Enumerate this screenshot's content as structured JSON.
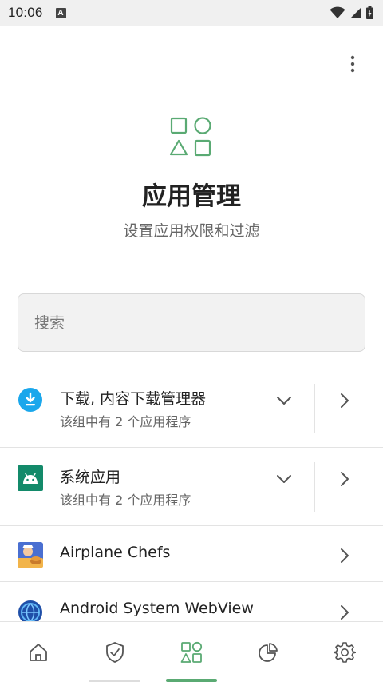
{
  "status_bar": {
    "time": "10:06",
    "a_label": "A"
  },
  "header": {
    "title": "应用管理",
    "subtitle": "设置应用权限和过滤",
    "icon": "apps-shapes-icon"
  },
  "search": {
    "placeholder": "搜索",
    "value": ""
  },
  "list": {
    "groups": [
      {
        "title": "下载, 内容下载管理器",
        "subtitle": "该组中有 2 个应用程序",
        "icon": "download-icon"
      },
      {
        "title": "系统应用",
        "subtitle": "该组中有 2 个应用程序",
        "icon": "android-icon"
      }
    ],
    "apps": [
      {
        "title": "Airplane Chefs",
        "icon": "airplane-chefs-icon"
      },
      {
        "title": "Android System WebView",
        "icon": "webview-icon"
      }
    ]
  },
  "bottom_nav": {
    "items": [
      {
        "icon": "home-icon"
      },
      {
        "icon": "shield-icon"
      },
      {
        "icon": "apps-icon",
        "selected": true
      },
      {
        "icon": "pie-chart-icon"
      },
      {
        "icon": "gear-icon"
      }
    ]
  },
  "colors": {
    "accent": "#5aaa73",
    "download_blue": "#1aa7ec",
    "android_green": "#138a6a"
  }
}
